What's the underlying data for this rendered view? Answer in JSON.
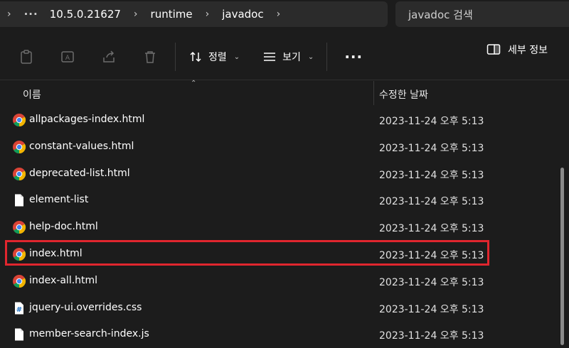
{
  "breadcrumb": {
    "items": [
      "10.5.0.21627",
      "runtime",
      "javadoc"
    ]
  },
  "search": {
    "placeholder": "javadoc 검색"
  },
  "toolbar": {
    "sort_label": "정렬",
    "view_label": "보기",
    "details_label": "세부 정보"
  },
  "columns": {
    "name": "이름",
    "date": "수정한 날짜"
  },
  "files": [
    {
      "name": "allpackages-index.html",
      "date": "2023-11-24 오후 5:13",
      "type": "chrome"
    },
    {
      "name": "constant-values.html",
      "date": "2023-11-24 오후 5:13",
      "type": "chrome"
    },
    {
      "name": "deprecated-list.html",
      "date": "2023-11-24 오후 5:13",
      "type": "chrome"
    },
    {
      "name": "element-list",
      "date": "2023-11-24 오후 5:13",
      "type": "file"
    },
    {
      "name": "help-doc.html",
      "date": "2023-11-24 오후 5:13",
      "type": "chrome"
    },
    {
      "name": "index.html",
      "date": "2023-11-24 오후 5:13",
      "type": "chrome"
    },
    {
      "name": "index-all.html",
      "date": "2023-11-24 오후 5:13",
      "type": "chrome"
    },
    {
      "name": "jquery-ui.overrides.css",
      "date": "2023-11-24 오후 5:13",
      "type": "css"
    },
    {
      "name": "member-search-index.js",
      "date": "2023-11-24 오후 5:13",
      "type": "file"
    }
  ],
  "colors": {
    "highlight": "#e0262e",
    "background": "#1c1c1c"
  }
}
